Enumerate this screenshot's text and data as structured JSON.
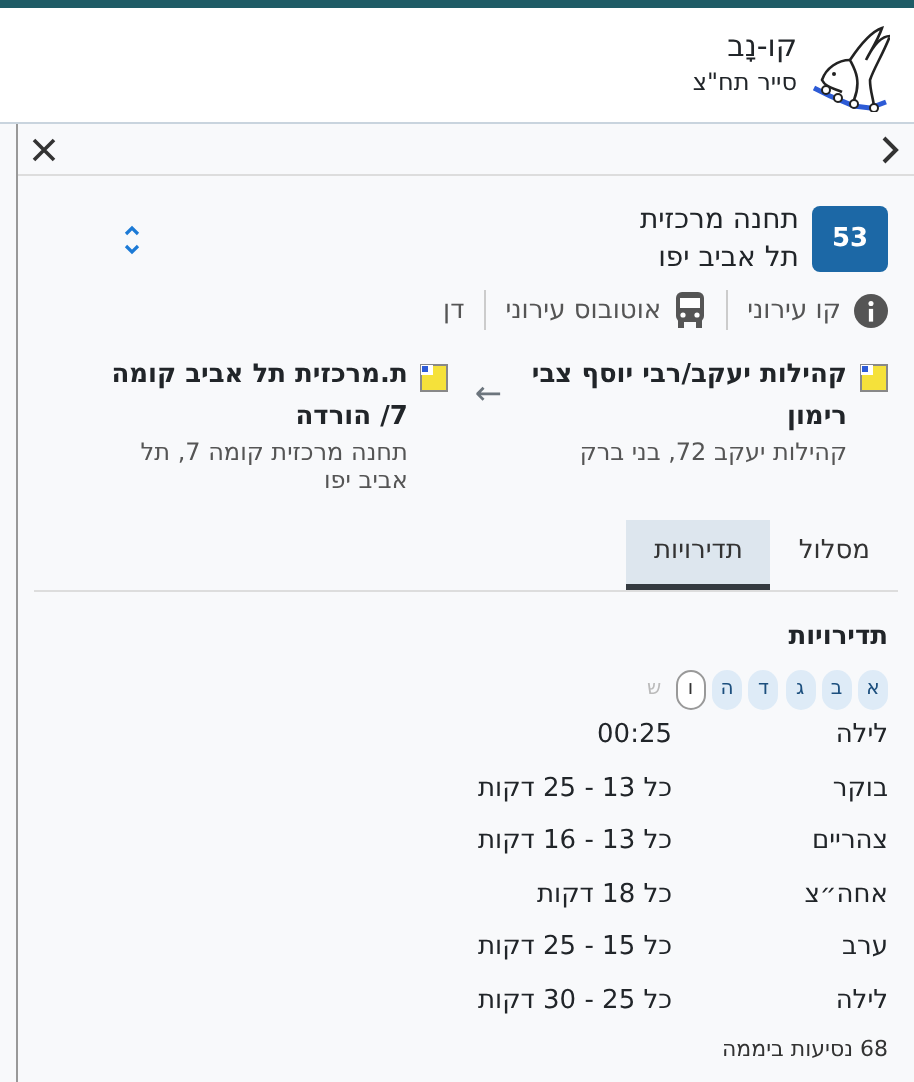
{
  "header": {
    "app_name": "קו-נָב",
    "subtitle": "סייר תח\"צ"
  },
  "line": {
    "number": "53",
    "origin": "תחנה מרכזית",
    "city": "תל אביב יפו"
  },
  "info": [
    {
      "kind": "info",
      "text": "קו עירוני"
    },
    {
      "kind": "bus",
      "text": "אוטובוס עירוני"
    },
    {
      "kind": "plain",
      "text": "דן"
    }
  ],
  "route": {
    "from": {
      "name": "קהילות יעקב/רבי יוסף צבי רימון",
      "address": "קהילות יעקב 72, בני ברק"
    },
    "arrow": "←",
    "to": {
      "name": "ת.מרכזית תל אביב קומה 7/ הורדה",
      "address": "תחנה מרכזית קומה 7, תל אביב יפו"
    }
  },
  "tabs": [
    {
      "label": "מסלול",
      "selected": false
    },
    {
      "label": "תדירויות",
      "selected": true
    }
  ],
  "frequencies": {
    "title": "תדירויות",
    "days": [
      {
        "label": "א",
        "selected": false,
        "disabled": false
      },
      {
        "label": "ב",
        "selected": false,
        "disabled": false
      },
      {
        "label": "ג",
        "selected": false,
        "disabled": false
      },
      {
        "label": "ד",
        "selected": false,
        "disabled": false
      },
      {
        "label": "ה",
        "selected": false,
        "disabled": false
      },
      {
        "label": "ו",
        "selected": true,
        "disabled": false
      },
      {
        "label": "ש",
        "selected": false,
        "disabled": true
      }
    ],
    "rows": [
      {
        "period": "לילה",
        "value": "00:25"
      },
      {
        "period": "בוקר",
        "value": "כל 13 - 25 דקות"
      },
      {
        "period": "צהריים",
        "value": "כל 13 - 16 דקות"
      },
      {
        "period": "אחה״צ",
        "value": "כל 18 דקות"
      },
      {
        "period": "ערב",
        "value": "כל 15 - 25 דקות"
      },
      {
        "period": "לילה",
        "value": "כל 25 - 30 דקות"
      }
    ],
    "total": "68 נסיעות ביממה"
  }
}
